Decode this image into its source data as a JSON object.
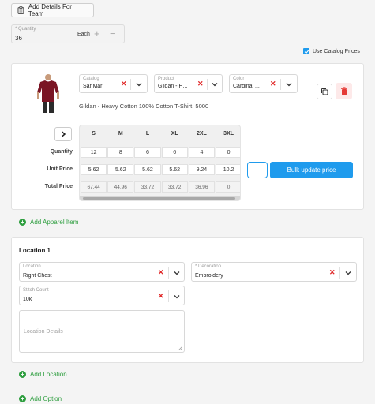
{
  "top": {
    "add_details_label": "Add Details For Team"
  },
  "quantity": {
    "label": "* Quantity",
    "value": "36",
    "unit": "Each"
  },
  "catalog_prices": {
    "label": "Use Catalog Prices",
    "checked": true
  },
  "apparel": {
    "catalog": {
      "label": "Catalog",
      "value": "SanMar"
    },
    "product": {
      "label": "Product",
      "value": "Gildan - H..."
    },
    "color": {
      "label": "Color",
      "value": "Cardinal ..."
    },
    "product_name": "Gildan - Heavy Cotton 100% Cotton T-Shirt. 5000",
    "sizes": [
      "S",
      "M",
      "L",
      "XL",
      "2XL",
      "3XL"
    ],
    "row_labels": [
      "Quantity",
      "Unit Price",
      "Total Price"
    ],
    "quantities": [
      "12",
      "8",
      "6",
      "6",
      "4",
      "0"
    ],
    "unit_prices": [
      "5.62",
      "5.62",
      "5.62",
      "5.62",
      "9.24",
      "10.2"
    ],
    "total_prices": [
      "67.44",
      "44.96",
      "33.72",
      "33.72",
      "36.96",
      "0"
    ],
    "bulk_update_label": "Bulk update price"
  },
  "add_apparel_label": "Add Apparel Item",
  "location": {
    "title": "Location 1",
    "location_field": {
      "label": "Location",
      "value": "Right Chest"
    },
    "decoration_field": {
      "label": "* Decoration",
      "value": "Embroidery"
    },
    "stitch_field": {
      "label": "Stitch Count",
      "value": "10k"
    },
    "details_placeholder": "Location Details"
  },
  "add_location_label": "Add Location",
  "add_option_label": "Add Option",
  "colors": {
    "accent_blue": "#1f9bed",
    "green": "#2e9e3f",
    "delete_red": "#e53935"
  }
}
